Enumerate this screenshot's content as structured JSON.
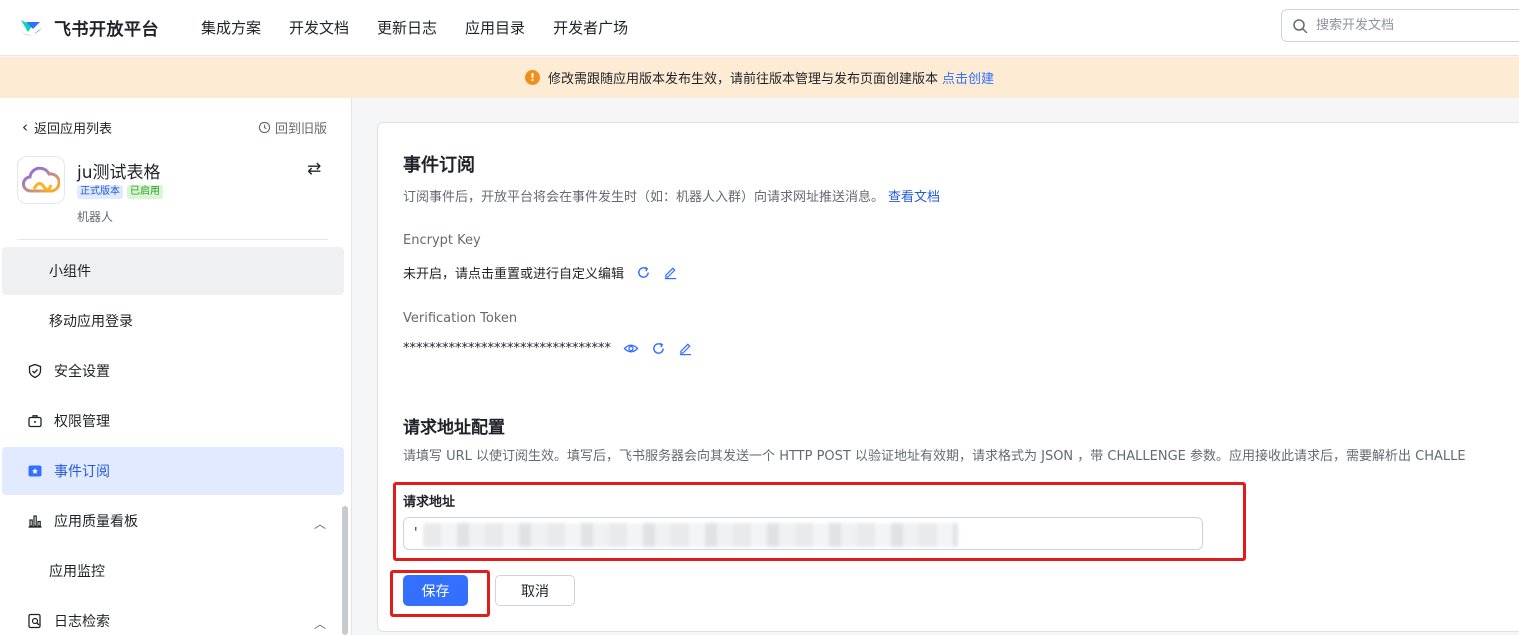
{
  "topnav": {
    "brand": "飞书开放平台",
    "links": [
      "集成方案",
      "开发文档",
      "更新日志",
      "应用目录",
      "开发者广场"
    ],
    "search_placeholder": "搜索开发文档"
  },
  "banner": {
    "text": "修改需跟随应用版本发布生效，请前往版本管理与发布页面创建版本",
    "link": "点击创建"
  },
  "sidebar": {
    "back_label": "返回应用列表",
    "old_version_label": "回到旧版",
    "app": {
      "name": "ju测试表格",
      "badge_version": "正式版本",
      "badge_status": "已启用",
      "type": "机器人"
    },
    "items": [
      {
        "label": "小组件",
        "level": "sub",
        "state": "hover"
      },
      {
        "label": "移动应用登录",
        "level": "sub"
      },
      {
        "label": "安全设置",
        "level": "top",
        "icon": "shield-icon"
      },
      {
        "label": "权限管理",
        "level": "top",
        "icon": "briefcase-icon"
      },
      {
        "label": "事件订阅",
        "level": "top",
        "icon": "event-icon",
        "state": "active"
      },
      {
        "label": "应用质量看板",
        "level": "top",
        "icon": "bar-chart-icon",
        "expanded": true
      },
      {
        "label": "应用监控",
        "level": "sub"
      },
      {
        "label": "日志检索",
        "level": "top",
        "icon": "log-search-icon",
        "expanded": true
      }
    ]
  },
  "main": {
    "title": "事件订阅",
    "description": "订阅事件后，开放平台将会在事件发生时（如：机器人入群）向请求网址推送消息。",
    "doc_link": "查看文档",
    "encrypt_key": {
      "label": "Encrypt Key",
      "value": "未开启，请点击重置或进行自定义编辑"
    },
    "verification_token": {
      "label": "Verification Token",
      "value": "********************************"
    },
    "url_section": {
      "title": "请求地址配置",
      "description": "请填写 URL 以使订阅生效。填写后，飞书服务器会向其发送一个 HTTP POST 以验证地址有效期，请求格式为 JSON ，带 CHALLENGE 参数。应用接收此请求后，需要解析出 CHALLE",
      "field_label": "请求地址",
      "field_value": "'"
    },
    "save_label": "保存",
    "cancel_label": "取消"
  },
  "colors": {
    "primary": "#3370ff",
    "banner_bg": "#fdebd3",
    "warning": "#f08f1a",
    "annotation": "#e21b1b"
  }
}
